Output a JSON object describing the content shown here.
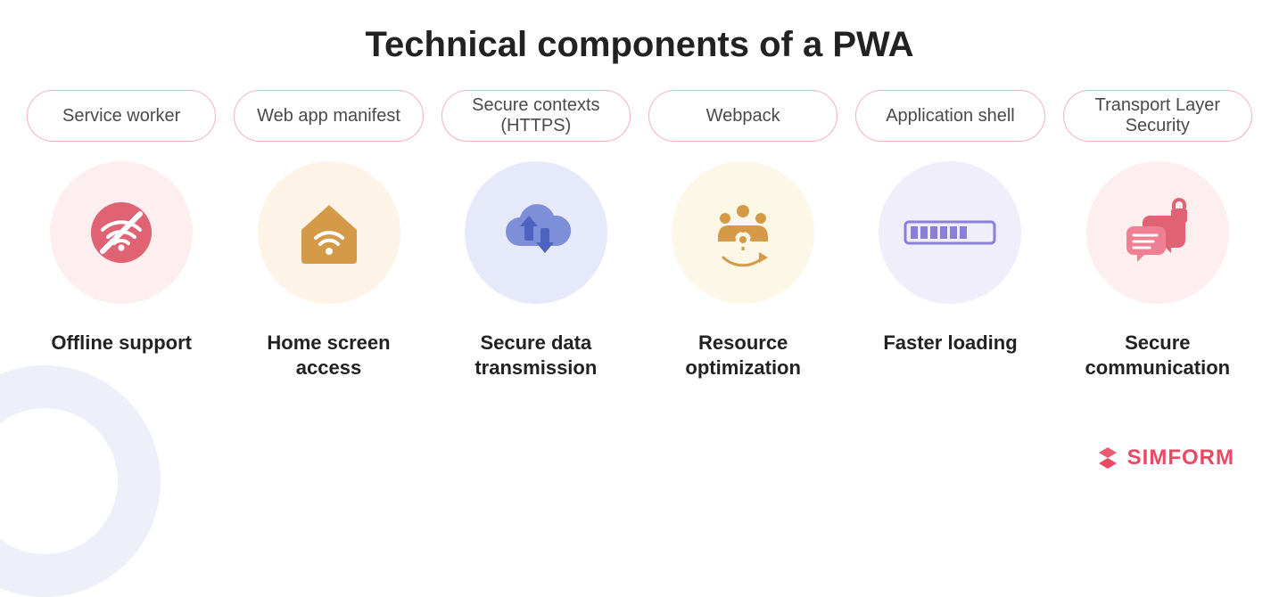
{
  "title": "Technical components of a PWA",
  "columns": [
    {
      "pill": "Service worker",
      "caption": "Offline support",
      "icon": "wifi-offline-icon",
      "circleClass": "pink"
    },
    {
      "pill": "Web app manifest",
      "caption": "Home screen access",
      "icon": "home-wifi-icon",
      "circleClass": "beige"
    },
    {
      "pill": "Secure contexts (HTTPS)",
      "caption": "Secure data transmission",
      "icon": "cloud-sync-icon",
      "circleClass": "lilac"
    },
    {
      "pill": "Webpack",
      "caption": "Resource optimization",
      "icon": "team-gear-icon",
      "circleClass": "cream"
    },
    {
      "pill": "Application shell",
      "caption": "Faster loading",
      "icon": "progress-bar-icon",
      "circleClass": "lav"
    },
    {
      "pill": "Transport Layer Security",
      "caption": "Secure communication",
      "icon": "secure-chat-icon",
      "circleClass": "rose"
    }
  ],
  "brand": {
    "name": "SIMFORM",
    "color": "#e84a64"
  },
  "colors": {
    "pill_border": "#f4b3bd",
    "bg_ring": "#e7eaf7",
    "text": "#222222"
  }
}
